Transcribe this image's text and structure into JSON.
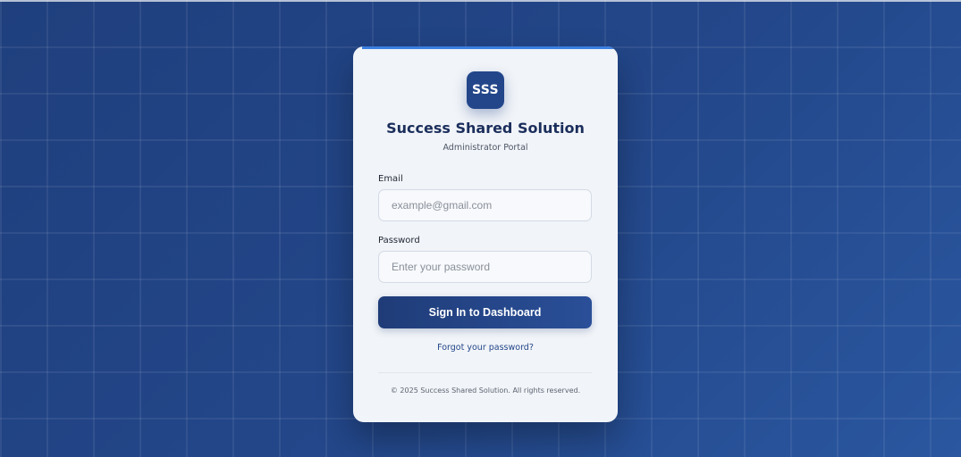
{
  "brand": {
    "logo_text": "SSS",
    "title": "Success Shared Solution",
    "subtitle": "Administrator Portal"
  },
  "form": {
    "email_label": "Email",
    "email_placeholder": "example@gmail.com",
    "email_value": "",
    "password_label": "Password",
    "password_placeholder": "Enter your password",
    "password_value": "",
    "submit_label": "Sign In to Dashboard",
    "forgot_label": "Forgot your password?"
  },
  "footer": {
    "copyright": "© 2025 Success Shared Solution. All rights reserved."
  },
  "colors": {
    "background": "#23478a",
    "card": "#f1f4f8",
    "primary": "#23468a",
    "accent": "#3b7fe0"
  }
}
